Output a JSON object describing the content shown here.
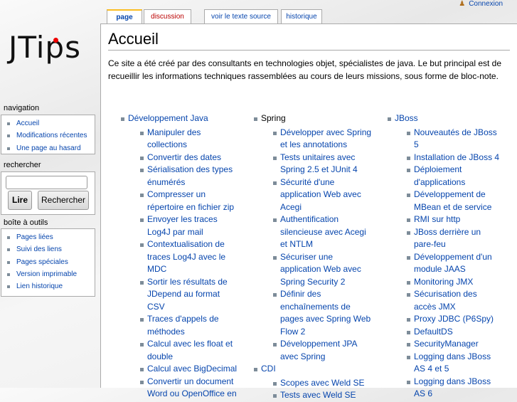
{
  "logo": "JTips",
  "user": {
    "login": "Connexion"
  },
  "tabs": [
    {
      "label": "page"
    },
    {
      "label": "discussion"
    },
    {
      "label": "voir le texte source"
    },
    {
      "label": "historique"
    }
  ],
  "page": {
    "title": "Accueil",
    "intro": "Ce site a été créé par des consultants en technologies objet, spécialistes de java. Le but principal est de recueillir les informations techniques rassemblées au cours de leurs missions, sous forme de bloc-note."
  },
  "sidebar": {
    "navigation": {
      "title": "navigation",
      "items": [
        "Accueil",
        "Modifications récentes",
        "Une page au hasard"
      ]
    },
    "search": {
      "title": "rechercher",
      "go": "Lire",
      "search": "Rechercher",
      "value": ""
    },
    "toolbox": {
      "title": "boîte à outils",
      "items": [
        "Pages liées",
        "Suivi des liens",
        "Pages spéciales",
        "Version imprimable",
        "Lien historique"
      ]
    }
  },
  "columns": [
    [
      {
        "title": "Développement Java",
        "items": [
          "Manipuler des collections",
          "Convertir des dates",
          "Sérialisation des types énumérés",
          "Compresser un répertoire en fichier zip",
          "Envoyer les traces Log4J par mail",
          "Contextualisation de traces Log4J avec le MDC",
          "Sortir les résultats de JDepend au format CSV",
          "Traces d'appels de méthodes",
          "Calcul avec les float et double",
          "Calcul avec BigDecimal",
          "Convertir un document Word ou OpenOffice en"
        ]
      }
    ],
    [
      {
        "title": "Spring",
        "items": [
          "Développer avec Spring et les annotations",
          "Tests unitaires avec Spring 2.5 et JUnit 4",
          "Sécurité d'une application Web avec Acegi",
          "Authentification silencieuse avec Acegi et NTLM",
          "Sécuriser une application Web avec Spring Security 2",
          "Définir des enchaînements de pages avec Spring Web Flow 2",
          "Développement JPA avec Spring"
        ]
      },
      {
        "title": "CDI",
        "items": [
          "Scopes avec Weld SE",
          "Tests avec Weld SE"
        ]
      }
    ],
    [
      {
        "title": "JBoss",
        "items": [
          "Nouveautés de JBoss 5",
          "Installation de JBoss 4",
          "Déploiement d'applications",
          "Développement de MBean et de service",
          "RMI sur http",
          "JBoss derrière un pare-feu",
          "Développement d'un module JAAS",
          "Monitoring JMX",
          "Sécurisation des accès JMX",
          "Proxy JDBC (P6Spy)",
          "DefaultDS",
          "SecurityManager",
          "Logging dans JBoss AS 4 et 5",
          "Logging dans JBoss AS 6"
        ]
      }
    ]
  ]
}
